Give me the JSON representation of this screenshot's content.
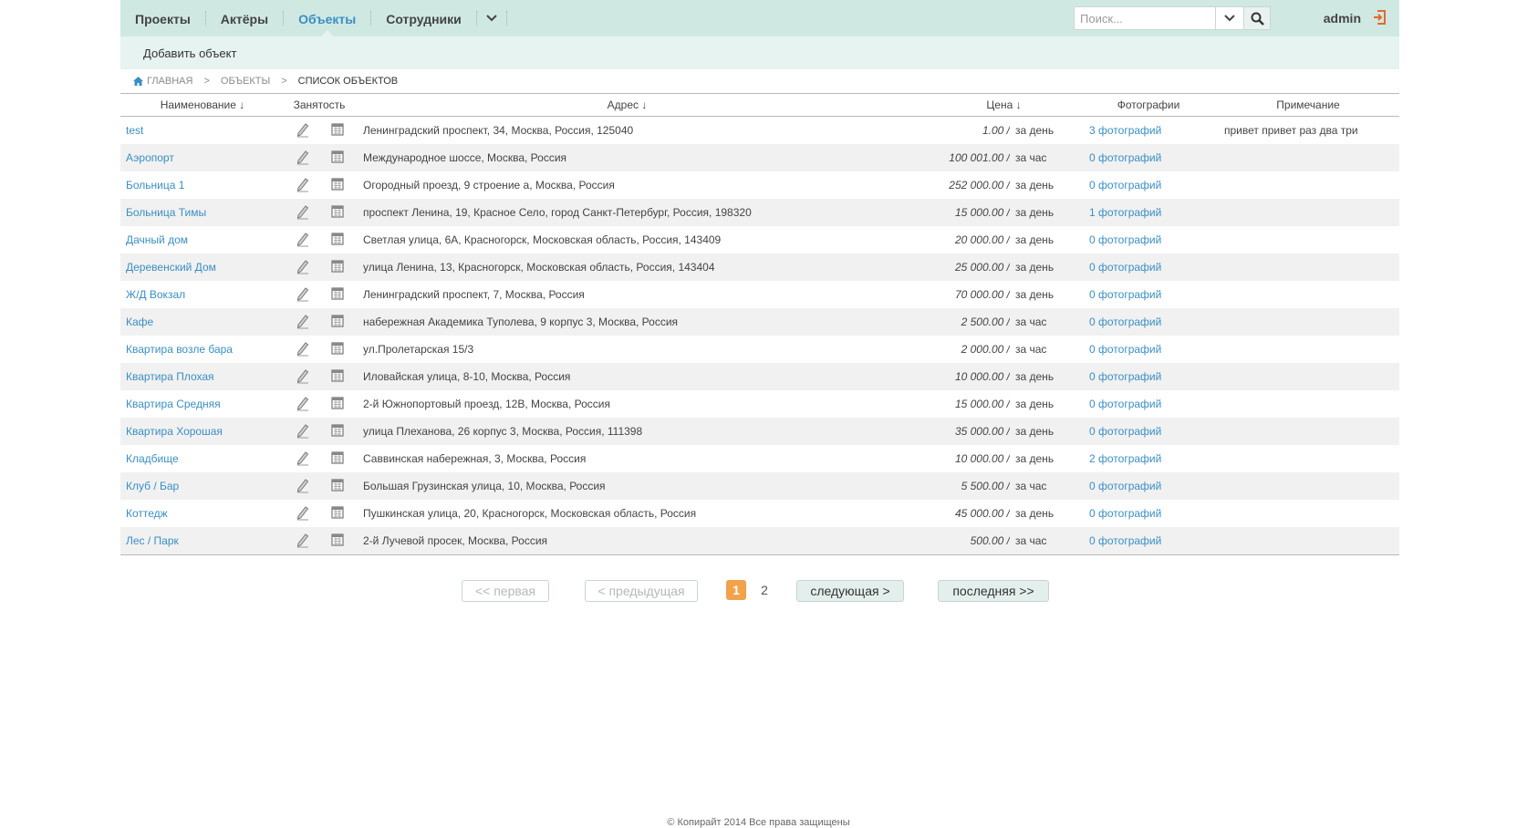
{
  "nav": {
    "items": [
      {
        "label": "Проекты"
      },
      {
        "label": "Актёры"
      },
      {
        "label": "Объекты"
      },
      {
        "label": "Сотрудники"
      }
    ],
    "active": "Объекты",
    "more_icon": "chevron-down-icon"
  },
  "search": {
    "placeholder": "Поиск...",
    "icon": "search-icon"
  },
  "user": {
    "name": "admin",
    "logout_icon": "logout-icon"
  },
  "subnav": {
    "add_label": "Добавить объект"
  },
  "breadcrumb": {
    "home": "ГЛАВНАЯ",
    "level1": "ОБЪЕКТЫ",
    "current": "СПИСОК ОБЪЕКТОВ",
    "separator": ">"
  },
  "table": {
    "headers": {
      "name": "Наименование ↓",
      "occupancy": "Занятость",
      "address": "Адрес ↓",
      "price": "Цена ↓",
      "photos": "Фотографии",
      "note": "Примечание"
    },
    "rows": [
      {
        "name": "test",
        "address": "Ленинградский проспект, 34, Москва, Россия, 125040",
        "price": "1.00 /",
        "unit": "за день",
        "photos": "3 фотографий",
        "note": "привет привет раз два три"
      },
      {
        "name": "Аэропорт",
        "address": "Международное шоссе, Москва, Россия",
        "price": "100 001.00 /",
        "unit": "за час",
        "photos": "0 фотографий",
        "note": ""
      },
      {
        "name": "Больница 1",
        "address": "Огородный проезд, 9 строение а, Москва, Россия",
        "price": "252 000.00 /",
        "unit": "за день",
        "photos": "0 фотографий",
        "note": ""
      },
      {
        "name": "Больница Тимы",
        "address": "проспект Ленина, 19, Красное Село, город Санкт-Петербург, Россия, 198320",
        "price": "15 000.00 /",
        "unit": "за день",
        "photos": "1 фотографий",
        "note": ""
      },
      {
        "name": "Дачный дом",
        "address": "Светлая улица, 6А, Красногорск, Московская область, Россия, 143409",
        "price": "20 000.00 /",
        "unit": "за день",
        "photos": "0 фотографий",
        "note": ""
      },
      {
        "name": "Деревенский Дом",
        "address": "улица Ленина, 13, Красногорск, Московская область, Россия, 143404",
        "price": "25 000.00 /",
        "unit": "за день",
        "photos": "0 фотографий",
        "note": ""
      },
      {
        "name": "Ж/Д Вокзал",
        "address": "Ленинградский проспект, 7, Москва, Россия",
        "price": "70 000.00 /",
        "unit": "за день",
        "photos": "0 фотографий",
        "note": ""
      },
      {
        "name": "Кафе",
        "address": "набережная Академика Туполева, 9 корпус 3, Москва, Россия",
        "price": "2 500.00 /",
        "unit": "за час",
        "photos": "0 фотографий",
        "note": ""
      },
      {
        "name": "Квартира возле бара",
        "address": "ул.Пролетарская 15/3",
        "price": "2 000.00 /",
        "unit": "за час",
        "photos": "0 фотографий",
        "note": ""
      },
      {
        "name": "Квартира Плохая",
        "address": "Иловайская улица, 8-10, Москва, Россия",
        "price": "10 000.00 /",
        "unit": "за день",
        "photos": "0 фотографий",
        "note": ""
      },
      {
        "name": "Квартира Средняя",
        "address": "2-й Южнопортовый проезд, 12В, Москва, Россия",
        "price": "15 000.00 /",
        "unit": "за день",
        "photos": "0 фотографий",
        "note": ""
      },
      {
        "name": "Квартира Хорошая",
        "address": "улица Плеханова, 26 корпус 3, Москва, Россия, 111398",
        "price": "35 000.00 /",
        "unit": "за день",
        "photos": "0 фотографий",
        "note": ""
      },
      {
        "name": "Кладбище",
        "address": "Саввинская набережная, 3, Москва, Россия",
        "price": "10 000.00 /",
        "unit": "за день",
        "photos": "2 фотографий",
        "note": ""
      },
      {
        "name": "Клуб / Бар",
        "address": "Большая Грузинская улица, 10, Москва, Россия",
        "price": "5 500.00 /",
        "unit": "за час",
        "photos": "0 фотографий",
        "note": ""
      },
      {
        "name": "Коттедж",
        "address": "Пушкинская улица, 20, Красногорск, Московская область, Россия",
        "price": "45 000.00 /",
        "unit": "за день",
        "photos": "0 фотографий",
        "note": ""
      },
      {
        "name": "Лес / Парк",
        "address": "2-й Лучевой просек, Москва, Россия",
        "price": "500.00 /",
        "unit": "за час",
        "photos": "0 фотографий",
        "note": ""
      }
    ],
    "row_icons": [
      "pencil-icon",
      "calendar-icon"
    ]
  },
  "pagination": {
    "first": "<<  первая",
    "prev": "<  предыдущая",
    "pages": [
      "1",
      "2"
    ],
    "current_page": "1",
    "next": "следующая  >",
    "last": "последняя  >>"
  },
  "footer": {
    "text": "© Копирайт 2014 Все права защищены"
  },
  "colors": {
    "topbar": "#cfe8e2",
    "subbar": "#e6f3f0",
    "link": "#3a8fc4",
    "current_page": "#f2a24a"
  }
}
